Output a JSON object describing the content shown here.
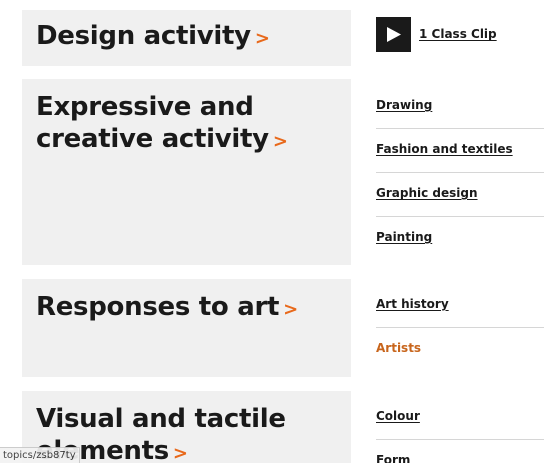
{
  "sections": [
    {
      "title": "Design activity",
      "chevron": ">",
      "clip": {
        "label": "1 Class Clip",
        "icon": "play-icon"
      }
    },
    {
      "title_lines": [
        "Expressive and",
        "creative activity"
      ],
      "chevron": ">",
      "links": [
        "Drawing",
        "Fashion and textiles",
        "Graphic design",
        "Painting"
      ]
    },
    {
      "title": "Responses to art",
      "chevron": ">",
      "links": [
        "Art history",
        "Artists"
      ]
    },
    {
      "title_lines": [
        "Visual and tactile",
        "elements"
      ],
      "chevron": ">",
      "links": [
        "Colour",
        "Form"
      ]
    }
  ],
  "status_bar": {
    "url": "topics/zsb87ty"
  },
  "colors": {
    "accent": "#e8691b",
    "panel_bg": "#f0f0f0",
    "text": "#1a1a1a",
    "visited_link": "#c8651c"
  }
}
